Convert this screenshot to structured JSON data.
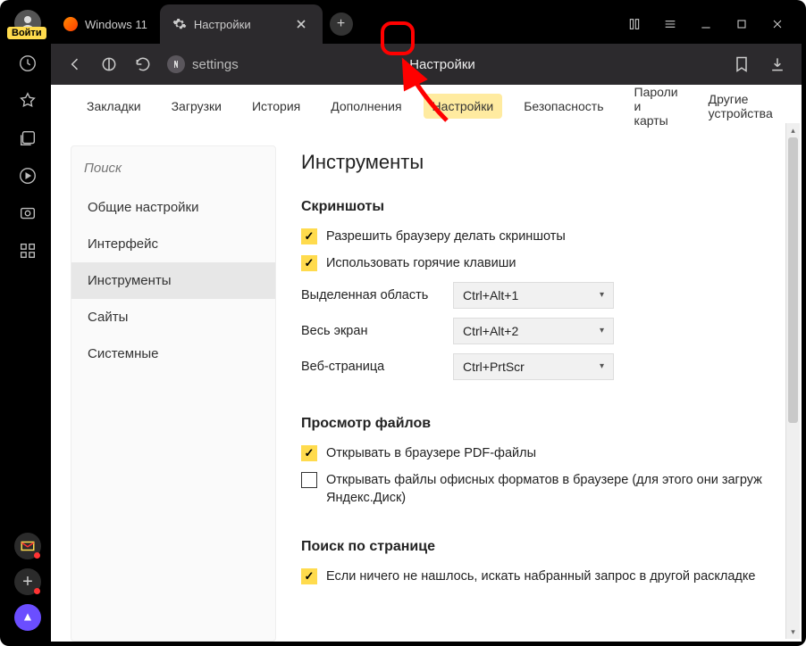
{
  "login_badge": "Войти",
  "tabs": [
    {
      "title": "Windows 11"
    },
    {
      "title": "Настройки"
    }
  ],
  "address": {
    "url_text": "settings",
    "page_title": "Настройки"
  },
  "sub_tabs": {
    "items": [
      "Закладки",
      "Загрузки",
      "История",
      "Дополнения",
      "Настройки",
      "Безопасность",
      "Пароли и карты",
      "Другие устройства"
    ],
    "active_index": 4
  },
  "settings_nav": {
    "search_placeholder": "Поиск",
    "items": [
      "Общие настройки",
      "Интерфейс",
      "Инструменты",
      "Сайты",
      "Системные"
    ],
    "active_index": 2
  },
  "settings": {
    "heading": "Инструменты",
    "screenshots": {
      "title": "Скриншоты",
      "allow": "Разрешить браузеру делать скриншоты",
      "hotkeys": "Использовать горячие клавиши",
      "rows": [
        {
          "label": "Выделенная область",
          "value": "Ctrl+Alt+1"
        },
        {
          "label": "Весь экран",
          "value": "Ctrl+Alt+2"
        },
        {
          "label": "Веб-страница",
          "value": "Ctrl+PrtScr"
        }
      ]
    },
    "viewer": {
      "title": "Просмотр файлов",
      "pdf": "Открывать в браузере PDF-файлы",
      "office": "Открывать файлы офисных форматов в браузере (для этого они загруж",
      "office2": "Яндекс.Диск)"
    },
    "pagesearch": {
      "title": "Поиск по странице",
      "opt1": "Если ничего не нашлось, искать набранный запрос в другой раскладке"
    }
  }
}
